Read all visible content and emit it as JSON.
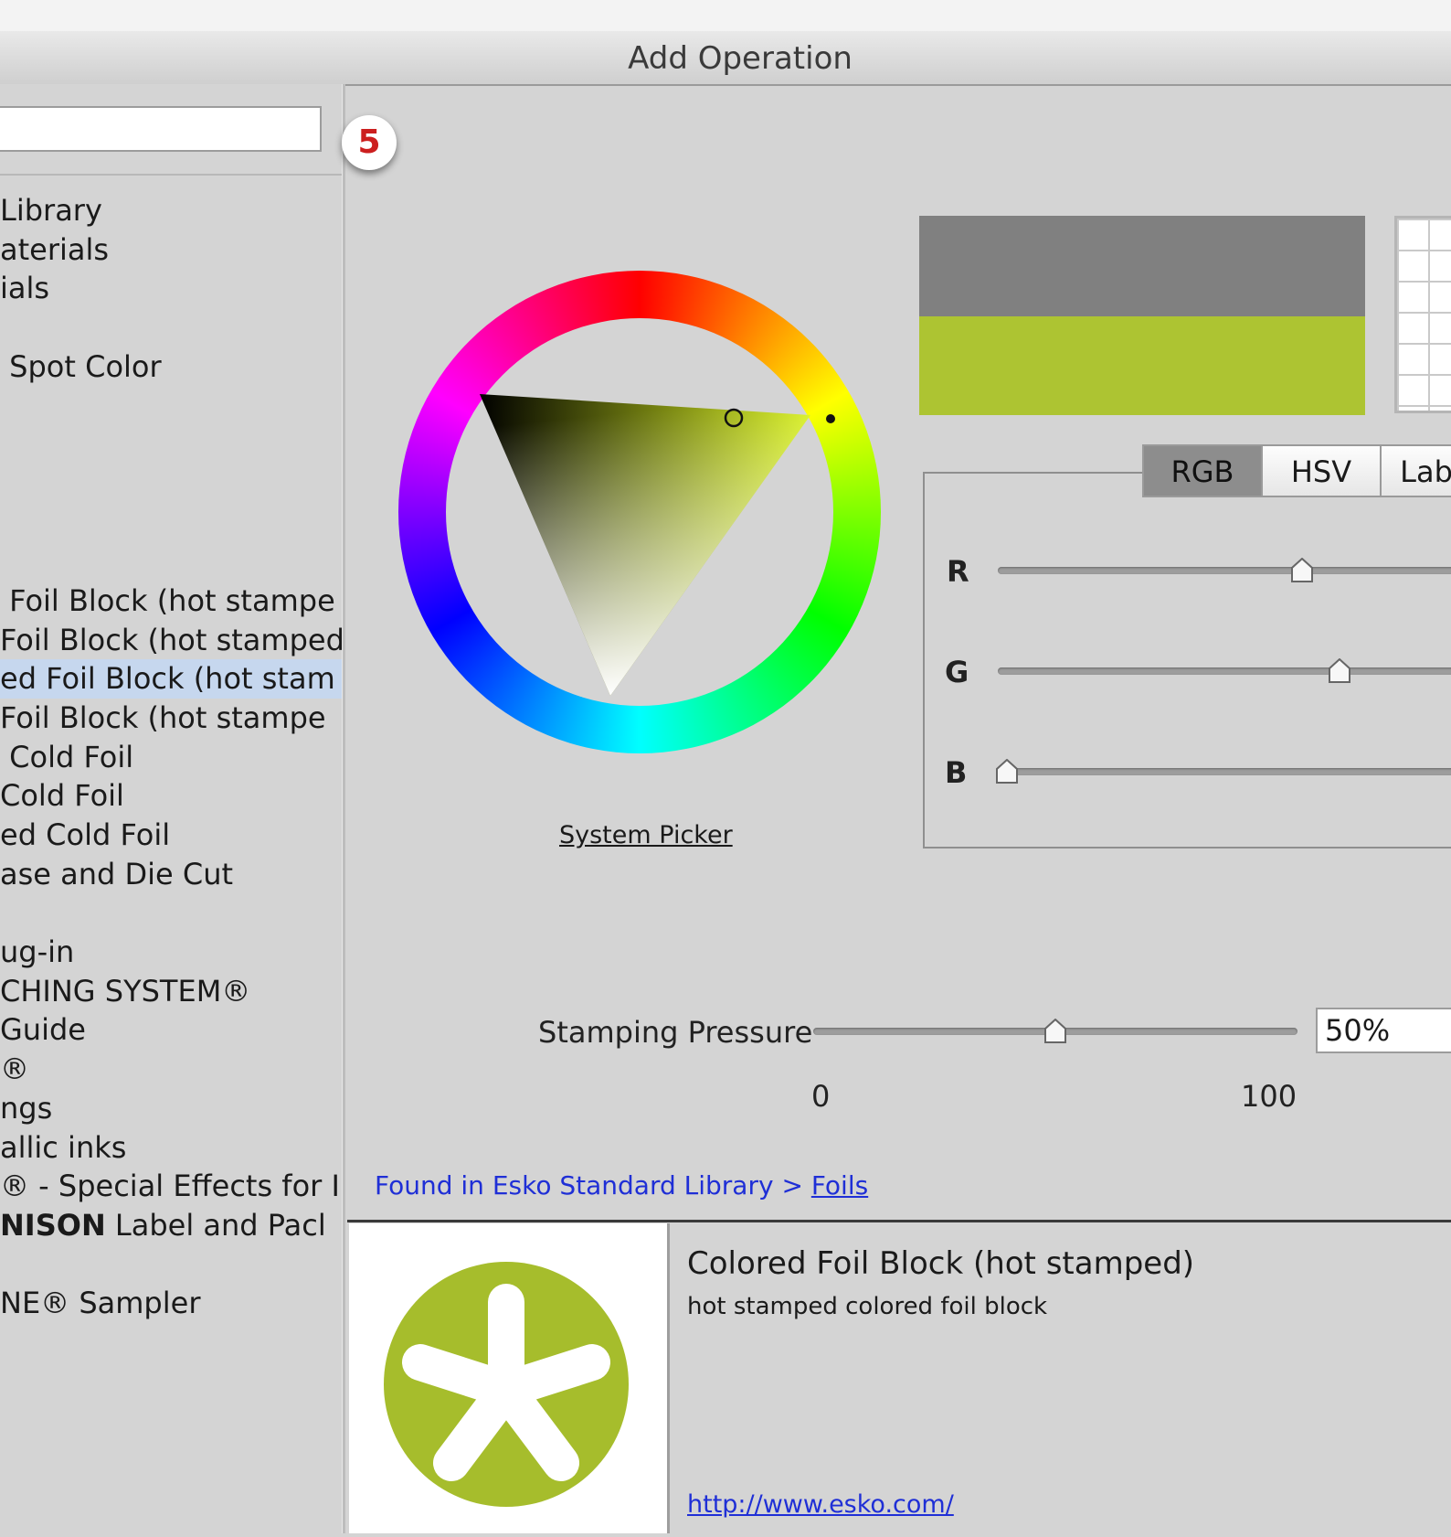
{
  "window": {
    "title": "Add Operation"
  },
  "search": {
    "value": ""
  },
  "annotation_badge": "5",
  "tree": {
    "items": [
      {
        "label": "Library"
      },
      {
        "label": "aterials"
      },
      {
        "label": "ials"
      },
      {
        "label": ""
      },
      {
        "label": " Spot Color"
      },
      {
        "label": ""
      },
      {
        "label": ""
      },
      {
        "label": ""
      },
      {
        "label": ""
      },
      {
        "label": ""
      },
      {
        "label": " Foil Block (hot stampe"
      },
      {
        "label": "Foil Block (hot stamped"
      },
      {
        "label": "ed Foil Block (hot stam",
        "selected": true
      },
      {
        "label": "Foil Block (hot stampe"
      },
      {
        "label": " Cold Foil"
      },
      {
        "label": "Cold Foil"
      },
      {
        "label": "ed Cold Foil"
      },
      {
        "label": "ase and Die Cut"
      },
      {
        "label": ""
      },
      {
        "label": "ug-in"
      },
      {
        "label": "CHING SYSTEM®"
      },
      {
        "label": "Guide"
      },
      {
        "label": "®"
      },
      {
        "label": "ngs"
      },
      {
        "label": "allic inks"
      },
      {
        "label": "® - Special Effects for I"
      },
      {
        "label_bold": "NISON",
        "label": " Label and Pacl"
      },
      {
        "label": ""
      },
      {
        "label": "NE® Sampler"
      }
    ]
  },
  "picker": {
    "system_picker_label": "System Picker",
    "old_color": "#808080",
    "new_color": "#adc432",
    "tabs": [
      {
        "label": "RGB",
        "active": true
      },
      {
        "label": "HSV",
        "active": false
      },
      {
        "label": "Lab",
        "active": false
      }
    ],
    "sliders": [
      {
        "label": "R",
        "level": 0.64
      },
      {
        "label": "G",
        "level": 0.72
      },
      {
        "label": "B",
        "level": 0.02
      }
    ]
  },
  "pressure": {
    "label": "Stamping Pressure",
    "value": "50%",
    "level": 0.5,
    "tick_min": "0",
    "tick_max": "100"
  },
  "found": {
    "prefix": "Found in Esko Standard Library > ",
    "link": "Foils"
  },
  "info": {
    "title": "Colored Foil Block (hot stamped)",
    "description": "hot stamped colored foil block",
    "url": "http://www.esko.com/",
    "logo_color": "#a6bd2c"
  }
}
